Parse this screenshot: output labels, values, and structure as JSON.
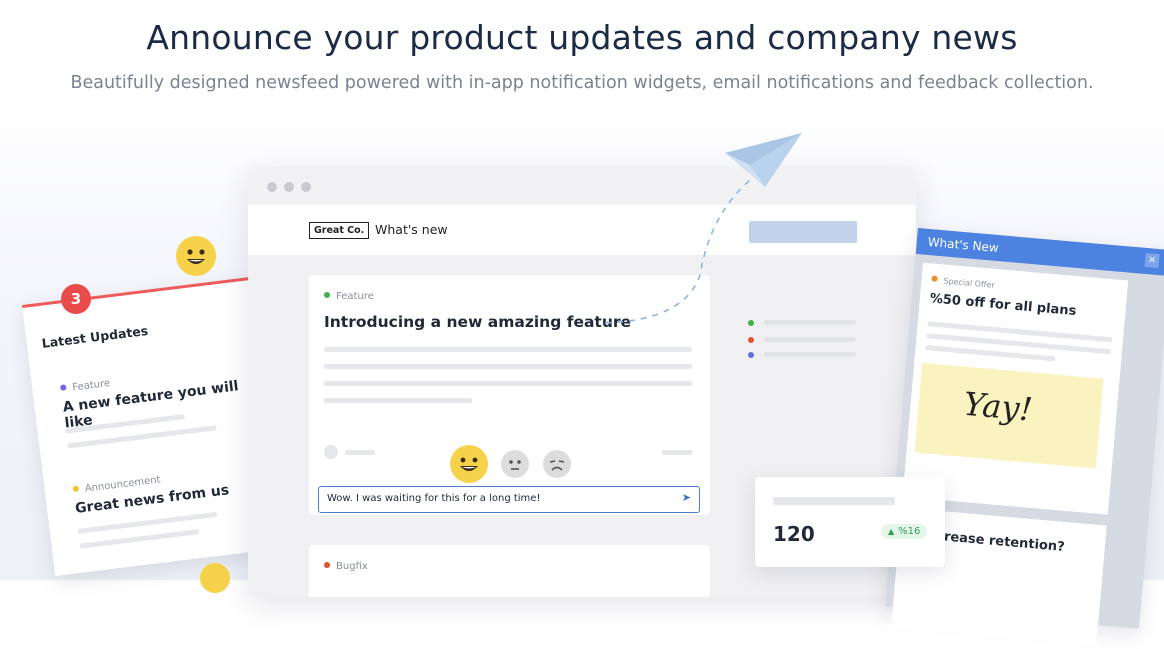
{
  "hero": {
    "title": "Announce your product updates and company news",
    "subtitle": "Beautifully designed newsfeed powered with in-app notification widgets, email notifications and feedback collection."
  },
  "app": {
    "logo": "Great Co.",
    "nav_link": "What's new",
    "post": {
      "tag": "Feature",
      "tag_color": "#3bb34a",
      "title": "Introducing a new amazing feature"
    },
    "reply": {
      "value": "Wow. I was waiting for this for a long time!",
      "send_icon": "send-icon"
    },
    "post2": {
      "tag": "Bugfix",
      "tag_color": "#e2522a"
    }
  },
  "left_widget": {
    "badge_count": "3",
    "title": "Latest Updates",
    "items": [
      {
        "tag": "Feature",
        "tag_color": "#7a5fe0",
        "title": "A new feature you will like"
      },
      {
        "tag": "Announcement",
        "tag_color": "#f2c230",
        "title": "Great news from us"
      }
    ]
  },
  "right_widget": {
    "title": "What's New",
    "close_label": "×",
    "offer_tag": "Special Offer",
    "offer_tag_color": "#f08a24",
    "offer_title": "%50 off for all plans",
    "yay": "Yay!",
    "question": "o increase retention?"
  },
  "metric": {
    "value": "120",
    "change": "%16"
  },
  "colors": {
    "accent": "#4c82e0",
    "badge": "#e94b4b"
  }
}
